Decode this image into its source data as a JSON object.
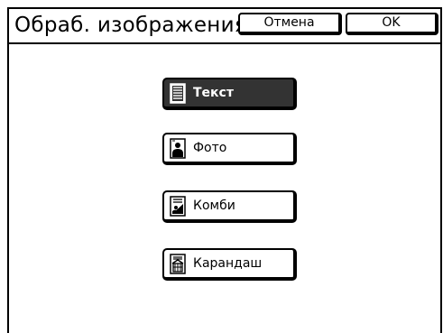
{
  "header": {
    "title": "Обраб. изображения",
    "cancel_label": "Отмена",
    "ok_label": "OK"
  },
  "modes": [
    {
      "label": "Текст",
      "icon": "text-document-icon",
      "selected": true
    },
    {
      "label": "Фото",
      "icon": "photo-portrait-icon",
      "selected": false
    },
    {
      "label": "Комби",
      "icon": "combi-document-icon",
      "selected": false
    },
    {
      "label": "Карандаш",
      "icon": "pencil-drawing-icon",
      "selected": false
    }
  ],
  "colors": {
    "selected_bg": "#333333",
    "border": "#000000",
    "background": "#ffffff"
  }
}
